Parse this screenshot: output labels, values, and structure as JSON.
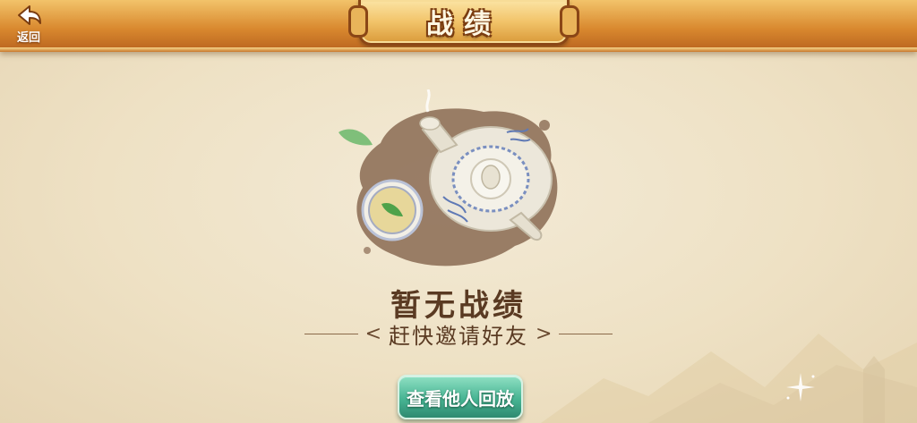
{
  "header": {
    "back_label": "返回",
    "title": "战绩"
  },
  "empty_state": {
    "title": "暂无战绩",
    "invite_bracket_left": "<",
    "invite_text": "赶快邀请好友",
    "invite_bracket_right": ">"
  },
  "actions": {
    "replay_button_label": "查看他人回放"
  },
  "colors": {
    "header_gold": "#d9892f",
    "button_teal": "#47b493",
    "text_brown": "#5a3a22",
    "background": "#f0e5cc"
  },
  "icons": {
    "back": "back-arrow-icon",
    "illustration": "teapot-teacup-illustration"
  }
}
